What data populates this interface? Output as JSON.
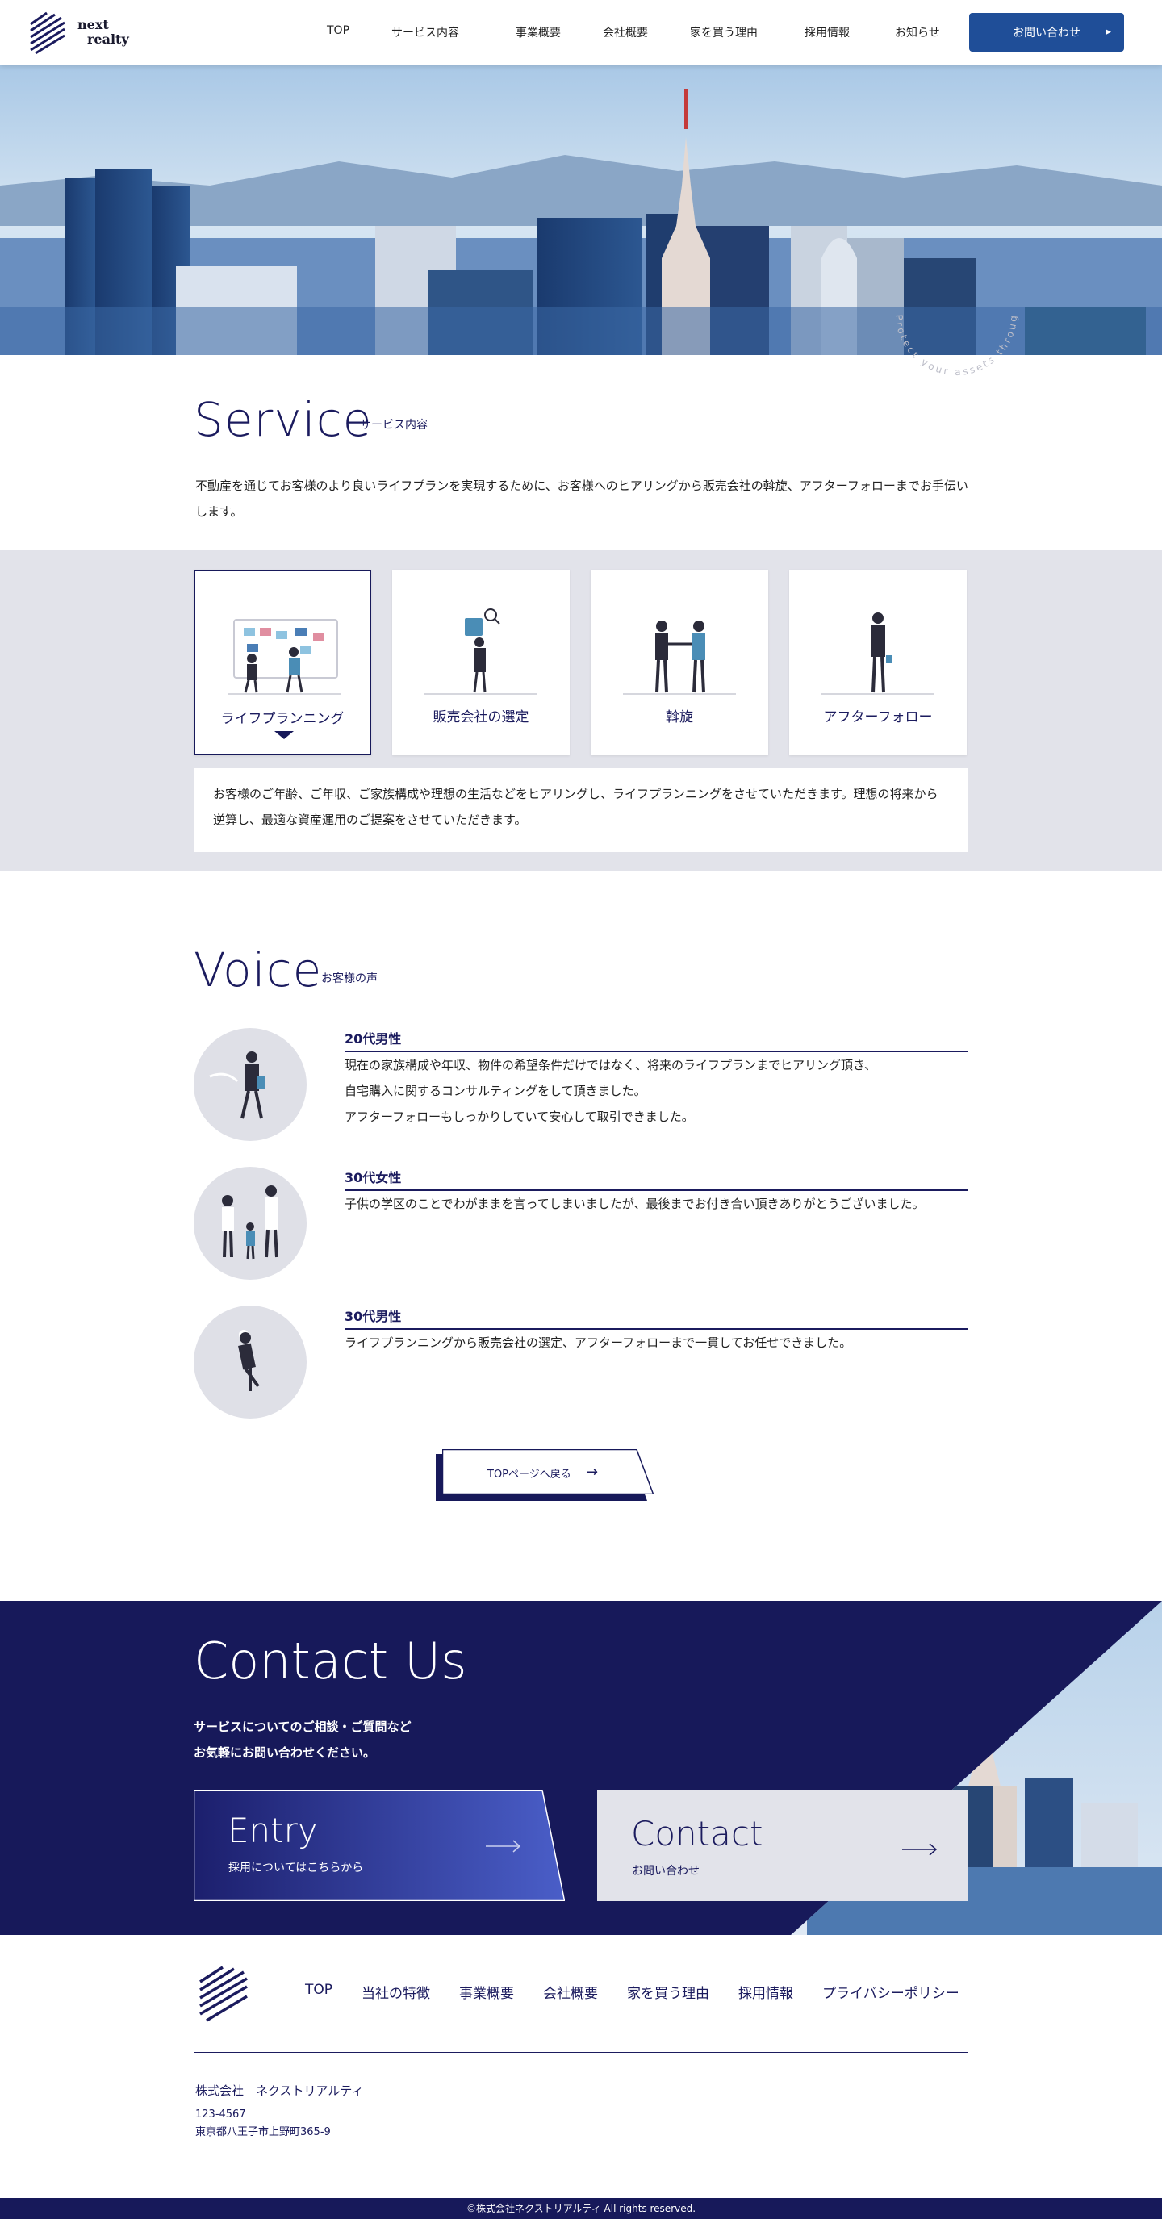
{
  "header": {
    "logo_line1": "next",
    "logo_line2": "realty",
    "nav": [
      "TOP",
      "サービス内容",
      "事業概要",
      "会社概要",
      "家を買う理由",
      "採用情報",
      "お知らせ"
    ],
    "contact_label": "お問い合わせ"
  },
  "hero": {
    "circle_text": "Protect your assets through"
  },
  "service": {
    "title": "Service",
    "subtitle": "サービス内容",
    "lead": "不動産を通じてお客様のより良いライフプランを実現するために、お客様へのヒアリングから販売会社の斡旋、アフターフォローまでお手伝いします。",
    "cards": [
      {
        "label": "ライフプランニング",
        "active": true
      },
      {
        "label": "販売会社の選定",
        "active": false
      },
      {
        "label": "斡旋",
        "active": false
      },
      {
        "label": "アフターフォロー",
        "active": false
      }
    ],
    "description": "お客様のご年齢、ご年収、ご家族構成や理想の生活などをヒアリングし、ライフプランニングをさせていただきます。理想の将来から逆算し、最適な資産運用のご提案をさせていただきます。"
  },
  "voice": {
    "title": "Voice",
    "subtitle": "お客様の声",
    "items": [
      {
        "name": "20代男性",
        "text": "現在の家族構成や年収、物件の希望条件だけではなく、将来のライフプランまでヒアリング頂き、\n自宅購入に関するコンサルティングをして頂きました。\nアフターフォローもしっかりしていて安心して取引できました。"
      },
      {
        "name": "30代女性",
        "text": "子供の学区のことでわがままを言ってしまいましたが、最後までお付き合い頂きありがとうございました。"
      },
      {
        "name": "30代男性",
        "text": "ライフプランニングから販売会社の選定、アフターフォローまで一貫してお任せできました。"
      }
    ],
    "back_label": "TOPページへ戻る"
  },
  "contact": {
    "title": "Contact Us",
    "lead_line1": "サービスについてのご相談・ご質問など",
    "lead_line2": "お気軽にお問い合わせください。",
    "entry_title": "Entry",
    "entry_sub": "採用についてはこちらから",
    "contact_title": "Contact",
    "contact_sub": "お問い合わせ"
  },
  "footer": {
    "nav": [
      "TOP",
      "当社の特徴",
      "事業概要",
      "会社概要",
      "家を買う理由",
      "採用情報",
      "プライバシーポリシー"
    ],
    "company": "株式会社　ネクストリアルティ",
    "zip": "123-4567",
    "address": "東京都八王子市上野町365-9",
    "copyright": "©株式会社ネクストリアルティ All rights reserved."
  },
  "colors": {
    "navy": "#17195a",
    "accent_blue": "#1f4e98",
    "band_gray": "#e2e3ea"
  }
}
